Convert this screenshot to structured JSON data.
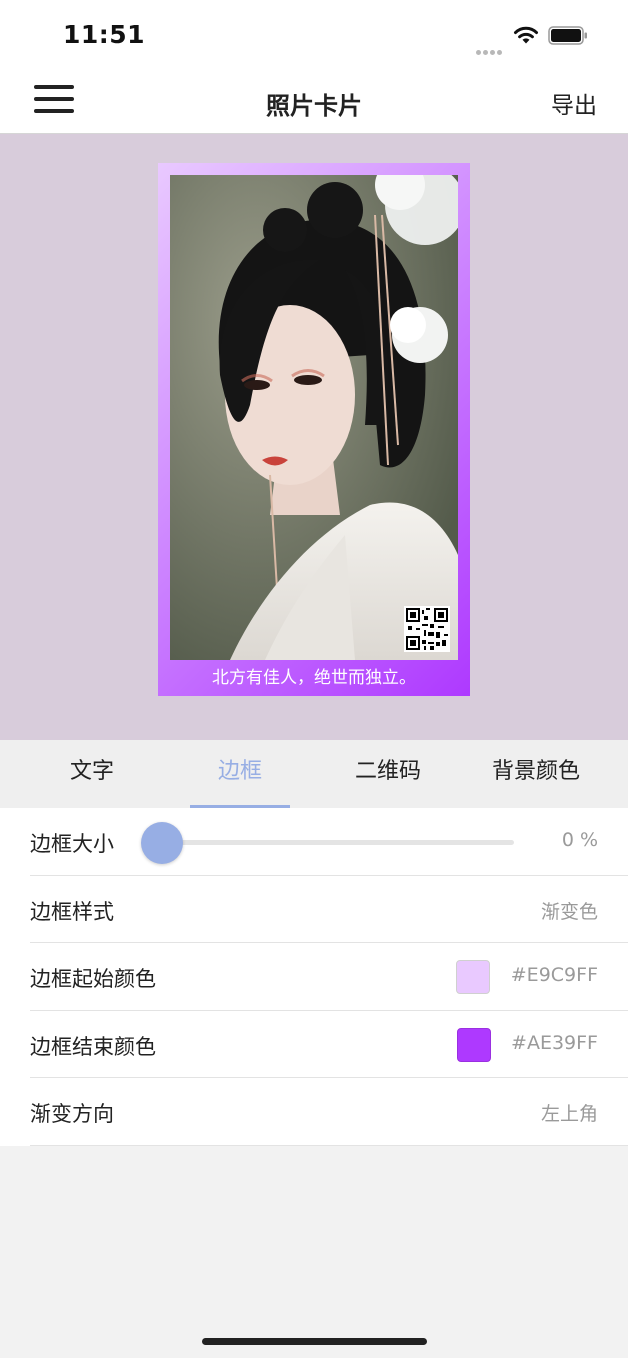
{
  "status_bar": {
    "time": "11:51"
  },
  "nav": {
    "title": "照片卡片",
    "export_label": "导出",
    "menu_icon": "hamburger-menu-icon"
  },
  "card": {
    "caption": "北方有佳人，绝世而独立。",
    "border_start_color": "#E9C9FF",
    "border_end_color": "#AE39FF",
    "preview_background": "#d8ccdb"
  },
  "tabs": [
    {
      "label": "文字",
      "active": false
    },
    {
      "label": "边框",
      "active": true
    },
    {
      "label": "二维码",
      "active": false
    },
    {
      "label": "背景颜色",
      "active": false
    }
  ],
  "settings": {
    "border_size": {
      "label": "边框大小",
      "value_text": "0 %",
      "value": 0
    },
    "border_style": {
      "label": "边框样式",
      "value": "渐变色"
    },
    "border_start_color": {
      "label": "边框起始颜色",
      "value": "#E9C9FF"
    },
    "border_end_color": {
      "label": "边框结束颜色",
      "value": "#AE39FF"
    },
    "gradient_direction": {
      "label": "渐变方向",
      "value": "左上角"
    }
  },
  "colors": {
    "accent": "#97aee4"
  }
}
